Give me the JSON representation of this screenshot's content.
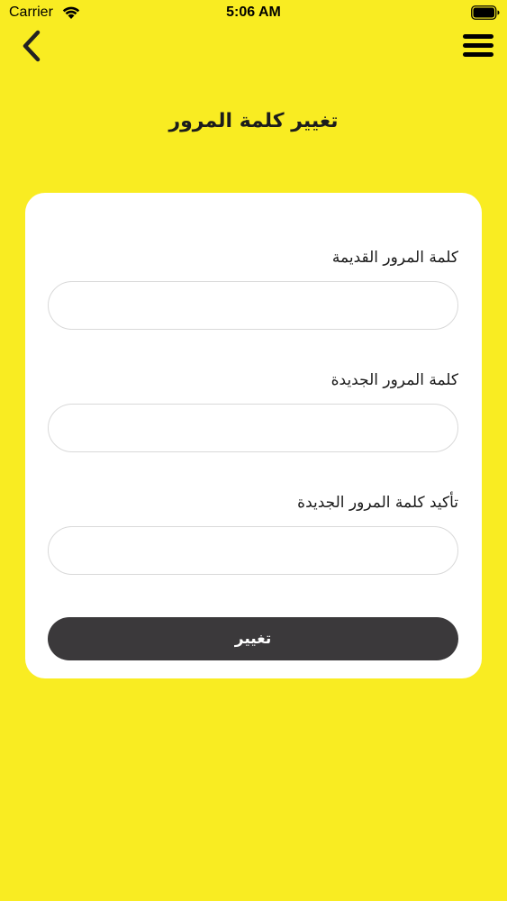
{
  "status_bar": {
    "carrier": "Carrier",
    "time": "5:06 AM"
  },
  "nav": {
    "back_icon": "chevron-left-icon",
    "menu_icon": "hamburger-menu-icon"
  },
  "page": {
    "title": "تغيير كلمة المرور"
  },
  "form": {
    "old_password_label": "كلمة المرور القديمة",
    "new_password_label": "كلمة المرور الجديدة",
    "confirm_password_label": "تأكيد كلمة المرور الجديدة",
    "old_password_value": "",
    "new_password_value": "",
    "confirm_password_value": "",
    "submit_label": "تغيير"
  },
  "colors": {
    "background": "#F9EC22",
    "card": "#FFFFFF",
    "button": "#3B393B",
    "button_text": "#FFFFFF"
  }
}
